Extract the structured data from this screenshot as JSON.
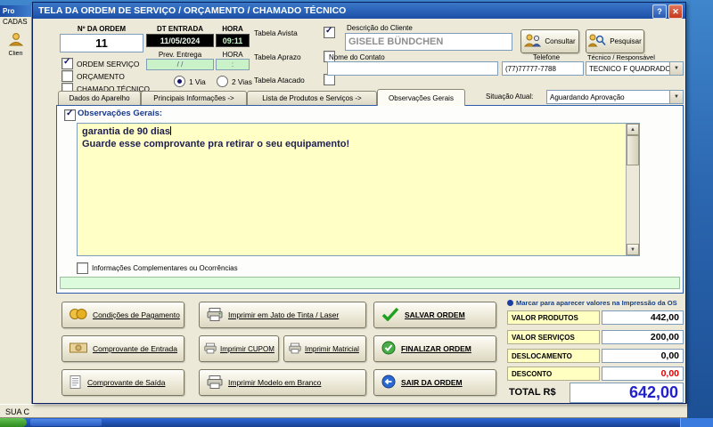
{
  "window": {
    "title": "TELA DA ORDEM DE SERVIÇO / ORÇAMENTO / CHAMADO TÉCNICO",
    "help_glyph": "?",
    "close_glyph": "✕"
  },
  "background": {
    "parent_title_fragment": "Pro",
    "parent_menu_fragment": "CADAS",
    "parent_icon_label": "Clien",
    "status_fragment": "SUA C"
  },
  "order_header": {
    "numero_label": "Nº DA ORDEM",
    "numero_value": "11",
    "dt_entrada_label": "DT ENTRADA",
    "hora_label": "HORA",
    "dt_entrada_value": "11/05/2024",
    "hora_value": "09:11",
    "tipos": [
      {
        "label": "ORDEM SERVIÇO",
        "checked": true
      },
      {
        "label": "ORÇAMENTO",
        "checked": false
      },
      {
        "label": "CHAMADO TÉCNICO",
        "checked": false
      }
    ],
    "prev_entrega_label": "Prev. Entrega",
    "prev_hora_label": "HORA",
    "prev_entrega_value": "/  /",
    "prev_hora_value": ":",
    "vias": [
      {
        "label": "1 Via",
        "selected": true
      },
      {
        "label": "2 Vias",
        "selected": false
      }
    ],
    "tabelas": [
      {
        "label": "Tabela Avista",
        "checked": true
      },
      {
        "label": "Tabela Aprazo",
        "checked": false
      },
      {
        "label": "Tabela Atacado",
        "checked": false
      }
    ]
  },
  "cliente": {
    "descricao_label": "Descrição do Cliente",
    "descricao_value": "GISELE BÜNDCHEN",
    "consultar_label": "Consultar",
    "pesquisar_label": "Pesquisar",
    "nome_contato_label": "Nome do Contato",
    "nome_contato_value": "",
    "telefone_label": "Telefone",
    "telefone_value": "(77)77777-7788",
    "tecnico_label": "Técnico / Responsável",
    "tecnico_value": "TECNICO F QUADRADO"
  },
  "tabs": {
    "items": [
      {
        "label": "Dados do Aparelho",
        "active": false
      },
      {
        "label": "Principais Informações ->",
        "active": false
      },
      {
        "label": "Lista de Produtos e Serviços ->",
        "active": false
      },
      {
        "label": "Observações Gerais",
        "active": true
      }
    ],
    "situacao_label": "Situação Atual:",
    "situacao_value": "Aguardando Aprovação"
  },
  "observacoes": {
    "titulo": "Observações Gerais:",
    "checked": true,
    "linha1": "garantia de 90 dias",
    "linha2": "Guarde esse comprovante pra retirar o seu equipamento!",
    "complementares_label": "Informações Complementares ou Ocorrências",
    "complementares_checked": false
  },
  "acoes": {
    "condicoes_pagamento": "Condições de Pagamento",
    "comprovante_entrada": "Comprovante de Entrada",
    "comprovante_saida": "Comprovante de Saída",
    "imprimir_jato": "Imprimir em Jato de Tinta / Laser",
    "imprimir_cupom": "Imprimir CUPOM",
    "imprimir_matricial": "Imprimir Matricial",
    "imprimir_modelo": "Imprimir Modelo em Branco",
    "salvar": "SALVAR ORDEM",
    "finalizar": "FINALIZAR ORDEM",
    "sair": "SAIR DA ORDEM"
  },
  "valores": {
    "header": "Marcar para aparecer valores na Impressão da OS",
    "rows": [
      {
        "label": "VALOR PRODUTOS",
        "value": "442,00"
      },
      {
        "label": "VALOR SERVIÇOS",
        "value": "200,00"
      },
      {
        "label": "DESLOCAMENTO",
        "value": "0,00"
      },
      {
        "label": "DESCONTO",
        "value": "0,00",
        "highlight": "red"
      }
    ],
    "total_label": "TOTAL R$",
    "total_value": "642,00",
    "total_color": "#2222cc",
    "desconto_color": "#dd0000"
  }
}
